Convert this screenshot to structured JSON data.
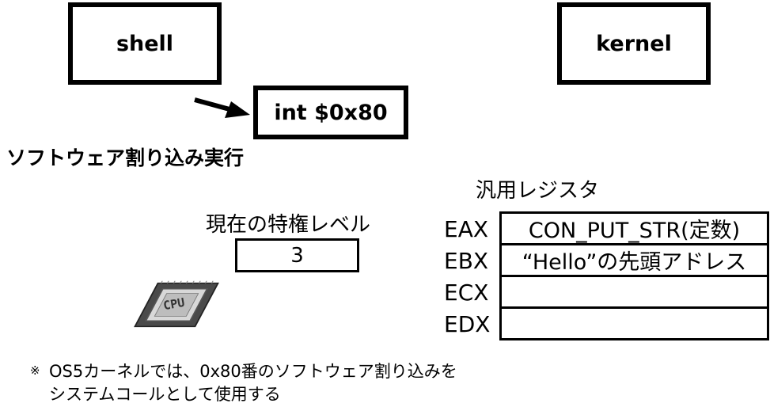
{
  "boxes": {
    "shell": "shell",
    "kernel": "kernel",
    "instruction": "int $0x80"
  },
  "heading": "ソフトウェア割り込み実行",
  "privilege": {
    "label": "現在の特権レベル",
    "value": "3"
  },
  "cpu_icon": {
    "text": "CPU"
  },
  "registers": {
    "title": "汎用レジスタ",
    "rows": [
      {
        "name": "EAX",
        "value": "CON_PUT_STR(定数)"
      },
      {
        "name": "EBX",
        "value": "“Hello”の先頭アドレス"
      },
      {
        "name": "ECX",
        "value": ""
      },
      {
        "name": "EDX",
        "value": ""
      }
    ]
  },
  "note": {
    "mark": "※",
    "line1": "OS5カーネルでは、0x80番のソフトウェア割り込みを",
    "line2": "システムコールとして使用する"
  }
}
